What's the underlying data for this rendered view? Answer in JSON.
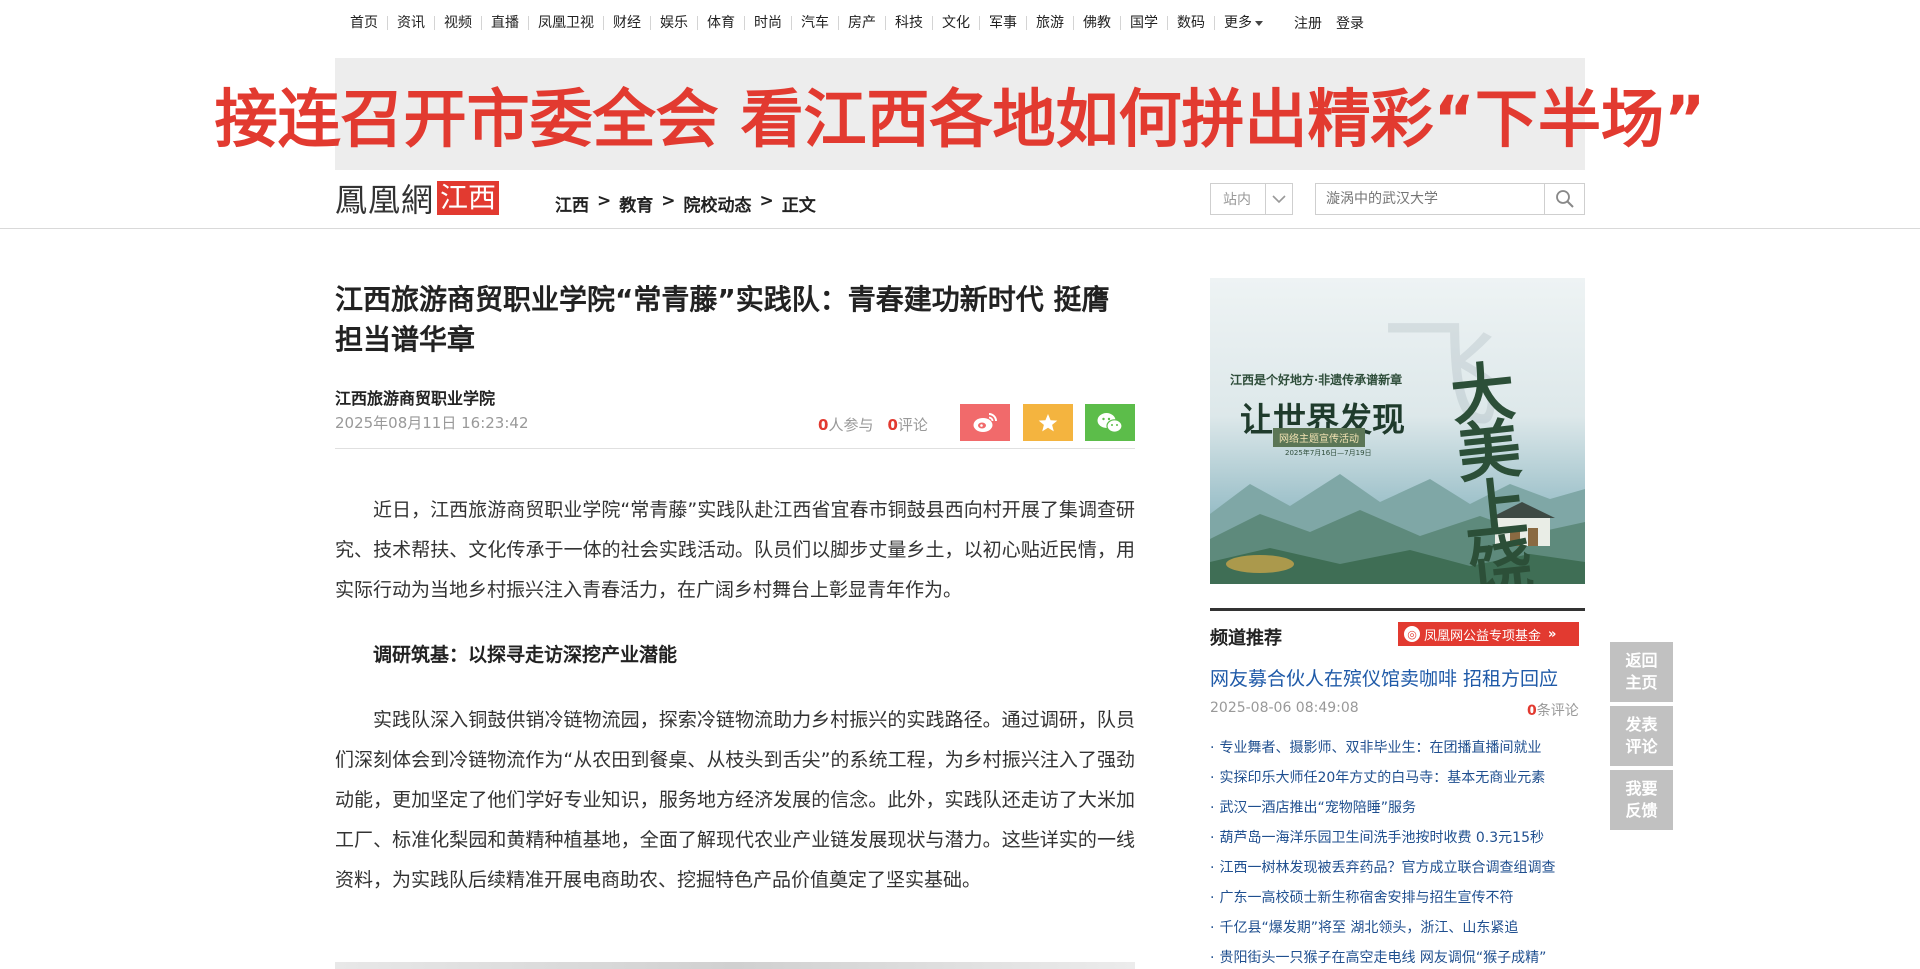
{
  "topnav": {
    "items": [
      "首页",
      "资讯",
      "视频",
      "直播",
      "凤凰卫视",
      "财经",
      "娱乐",
      "体育",
      "时尚",
      "汽车",
      "房产",
      "科技",
      "文化",
      "军事",
      "旅游",
      "佛教",
      "国学",
      "数码"
    ],
    "more_label": "更多",
    "register_label": "注册",
    "login_label": "登录"
  },
  "banner": {
    "text": "接连召开市委全会 看江西各地如何拼出精彩“下半场”"
  },
  "header": {
    "logo_text": "鳳凰網",
    "logo_region": "江西",
    "breadcrumb": [
      "江西",
      "教育",
      "院校动态",
      "正文"
    ],
    "breadcrumb_sep": ">",
    "site_select_label": "站内",
    "search_placeholder": "漩涡中的武汉大学"
  },
  "article": {
    "title": "江西旅游商贸职业学院“常青藤”实践队：青春建功新时代 挺膺担当谱华章",
    "source": "江西旅游商贸职业学院",
    "date": "2025年08月11日 16:23:42",
    "participants_count": "0",
    "participants_label": "人参与",
    "comments_count": "0",
    "comments_label": "评论",
    "paragraphs": [
      "近日，江西旅游商贸职业学院“常青藤”实践队赴江西省宜春市铜鼓县西向村开展了集调查研究、技术帮扶、文化传承于一体的社会实践活动。队员们以脚步丈量乡土，以初心贴近民情，用实际行动为当地乡村振兴注入青春活力，在广阔乡村舞台上彰显青年作为。",
      "调研筑基：以探寻走访深挖产业潜能",
      "实践队深入铜鼓供销冷链物流园，探索冷链物流助力乡村振兴的实践路径。通过调研，队员们深刻体会到冷链物流作为“从农田到餐桌、从枝头到舌尖”的系统工程，为乡村振兴注入了强劲动能，更加坚定了他们学好专业知识，服务地方经济发展的信念。此外，实践队还走访了大米加工厂、标准化梨园和黄精种植基地，全面了解现代农业产业链发展现状与潜力。这些详实的一线资料，为实践队后续精准开展电商助农、挖掘特色产品价值奠定了坚实基础。"
    ]
  },
  "side_ad": {
    "subtitle": "江西是个好地方·非遗传承谱新章",
    "main": "让世界发现",
    "brush": "大美上饶",
    "event": "网络主题宣传活动",
    "date": "2025年7月16日—7月19日"
  },
  "recommend": {
    "title": "频道推荐",
    "badge": "凤凰网公益专项基金",
    "headline": "网友募合伙人在殡仪馆卖咖啡 招租方回应",
    "headline_date": "2025-08-06 08:49:08",
    "headline_comments_count": "0",
    "headline_comments_label": "条评论",
    "items": [
      "专业舞者、摄影师、双非毕业生：在团播直播间就业",
      "实探印乐大师任20年方丈的白马寺：基本无商业元素",
      "武汉一酒店推出“宠物陪睡”服务",
      "葫芦岛一海洋乐园卫生间洗手池按时收费 0.3元15秒",
      "江西一树林发现被丢弃药品？官方成立联合调查组调查",
      "广东一高校硕士新生称宿舍安排与招生宣传不符",
      "千亿县“爆发期”将至 湖北领头，浙江、山东紧追",
      "贵阳街头一只猴子在高空走电线 网友调侃“猴子成精”"
    ]
  },
  "float_buttons": {
    "home": "返回主页",
    "comment": "发表评论",
    "feedback": "我要反馈"
  },
  "colors": {
    "brand_red": "#e23a30",
    "link_blue": "#1f5aa8",
    "weibo": "#f16a6b",
    "favorite": "#f4b43f",
    "wechat": "#5cbd4a",
    "float_gray": "#c1c1c1"
  },
  "icons": [
    "chevron-down-icon",
    "search-icon",
    "weibo-icon",
    "star-icon",
    "wechat-icon",
    "ifeng-logo-icon",
    "double-chevron-right-icon"
  ]
}
